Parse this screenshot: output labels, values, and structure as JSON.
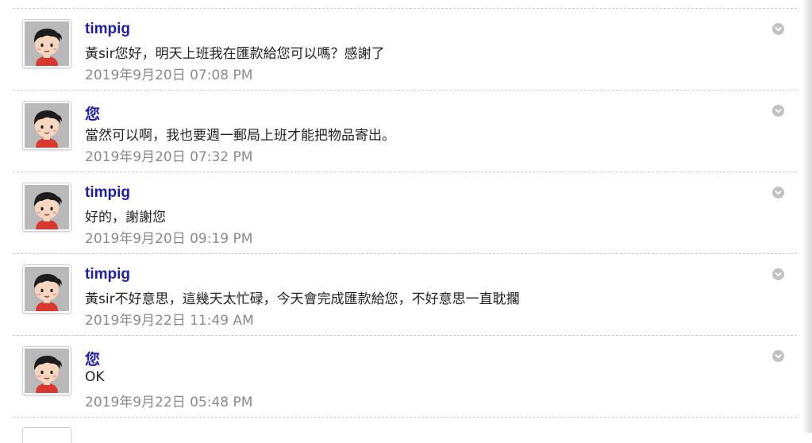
{
  "messages": [
    {
      "author": "timpig",
      "text": "黃sir您好，明天上班我在匯款給您可以嗎？感謝了",
      "time": "2019年9月20日 07:08 PM"
    },
    {
      "author": "您",
      "text": "當然可以啊，我也要週一郵局上班才能把物品寄出。",
      "time": "2019年9月20日 07:32 PM"
    },
    {
      "author": "timpig",
      "text": "好的，謝謝您",
      "time": "2019年9月20日 09:19 PM"
    },
    {
      "author": "timpig",
      "text": "黃sir不好意思，這幾天太忙碌，今天會完成匯款給您，不好意思一直耽擱",
      "time": "2019年9月22日 11:49 AM"
    },
    {
      "author": "您",
      "text": "OK",
      "time": "2019年9月22日 05:48 PM"
    }
  ],
  "icons": {
    "avatar": "boy-avatar-icon",
    "options": "chevron-down-circle-icon"
  },
  "colors": {
    "author": "#1e1ea8",
    "text": "#222222",
    "time": "#8a8a8a",
    "divider": "#c9c9c9",
    "options": "#c2c2c2"
  }
}
